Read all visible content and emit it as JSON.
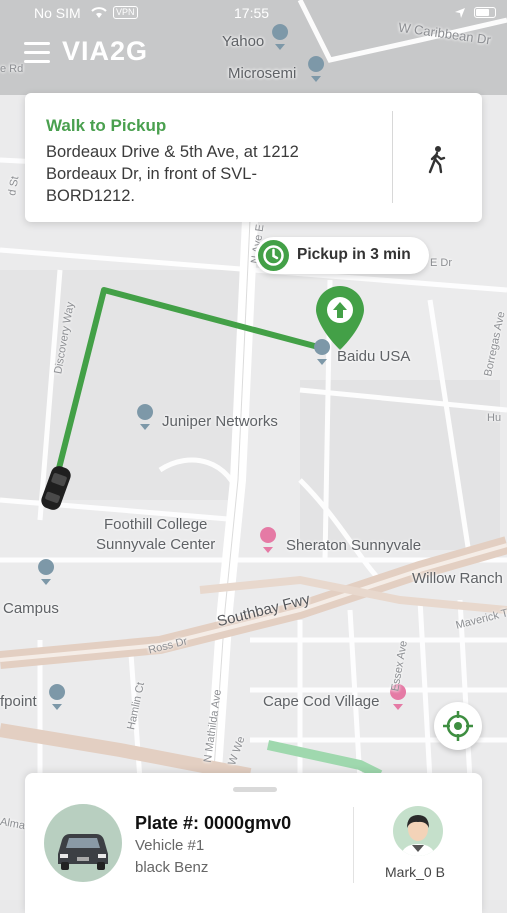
{
  "status_bar": {
    "carrier": "No SIM",
    "vpn": "VPN",
    "time": "17:55"
  },
  "app": {
    "logo": "VIA2G",
    "menu_icon": "hamburger-menu-icon"
  },
  "walk_card": {
    "title": "Walk to Pickup",
    "address_line1": "Bordeaux Drive & 5th Ave, at 1212",
    "address_line2": "Bordeaux Dr, in front of SVL-",
    "address_line3": "BORD1212.",
    "icon": "walking-person-icon",
    "title_color": "#4aa04f"
  },
  "pickup_pill": {
    "label": "Pickup in 3 min",
    "icon": "clock-icon"
  },
  "map": {
    "labels": {
      "yahoo": "Yahoo",
      "microsemi": "Microsemi",
      "w_caribbean": "W Caribbean Dr",
      "baidu": "Baidu USA",
      "juniper": "Juniper Networks",
      "foothill_1": "Foothill College",
      "foothill_2": "Sunnyvale Center",
      "sheraton": "Sheraton Sunnyvale",
      "willow": "Willow Ranch",
      "southbay": "Southbay Fwy",
      "campus": "Campus",
      "fpoint": "fpoint",
      "cape_cod": "Cape Cod Village",
      "mathilda": "N Mathilda Ave",
      "ross": "Ross Dr",
      "discovery": "Discovery Way",
      "borregas": "Borregas Ave",
      "essex": "Essex Ave",
      "maverick": "Maverick Terr",
      "hamlin": "Hamlin Ct",
      "ave_e": "N Ave E",
      "e_dr": "E Dr",
      "alma": "Alma",
      "sr": "W We",
      "ext_a": "e Rd",
      "ext_b": "d St",
      "hu": "Hu"
    },
    "route_color": "#43a047"
  },
  "recenter": {
    "icon": "recenter-target-icon"
  },
  "vehicle": {
    "plate": "Plate #: 0000gmv0",
    "number": "Vehicle #1",
    "description": "black Benz",
    "icon": "car-icon"
  },
  "driver": {
    "name": "Mark_0 B",
    "icon": "driver-avatar-icon"
  }
}
